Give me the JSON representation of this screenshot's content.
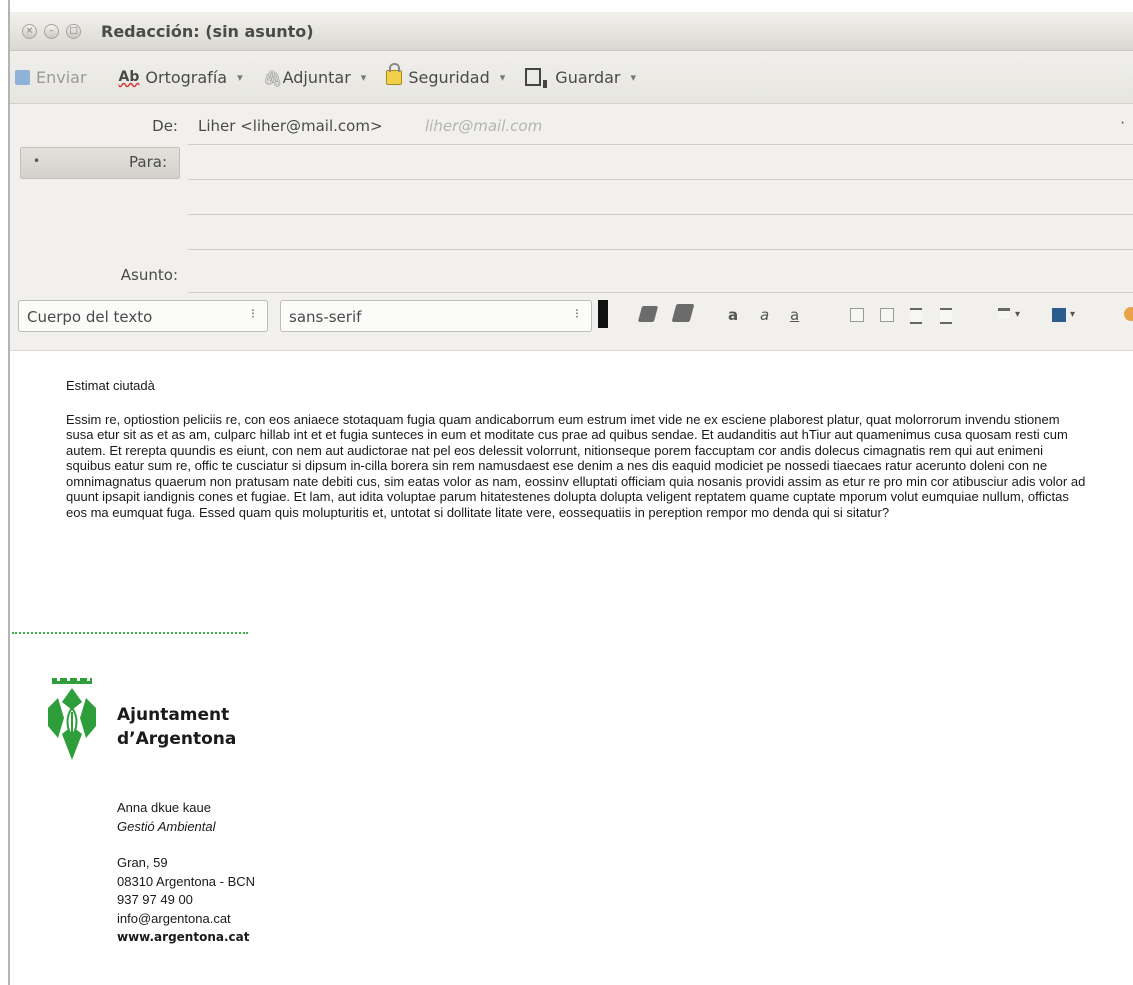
{
  "window": {
    "title": "Redacción: (sin asunto)",
    "close_glyph": "×",
    "minimize_glyph": "–",
    "maximize_glyph": "□"
  },
  "toolbar": {
    "send": "Enviar",
    "spelling_icon": "Ab",
    "spelling": "Ortografía",
    "attach_icon": "🖇",
    "attach": "Adjuntar",
    "security": "Seguridad",
    "save": "Guardar",
    "caret": "▾"
  },
  "header": {
    "from_label": "De:",
    "from_value": "Liher <liher@mail.com>",
    "from_email_hint": "liher@mail.com",
    "from_bullet": "·",
    "to_bullet": "•",
    "to_label": "Para:",
    "subject_label": "Asunto:"
  },
  "format": {
    "paragraph_style": "Cuerpo del texto",
    "font": "sans-serif",
    "spinner": "⁝",
    "text_a1": "a",
    "text_a2": "a",
    "text_a3": "a",
    "align_caret": "▾"
  },
  "body": {
    "greeting": "Estimat ciutadà",
    "paragraph": "Essim re, optiostion peliciis re, con eos aniaece stotaquam fugia quam andicaborrum eum estrum imet vide ne ex esciene plaborest platur, quat molorrorum invendu stionem susa etur sit as et as am, culparc hillab int et et fugia sunteces in eum et moditate cus prae ad quibus sendae. Et audanditis aut hTiur aut quamenimus cusa quosam resti cum autem. Et rerepta quundis es eiunt, con nem aut audictorae nat pel eos delessit volorrunt, nitionseque porem faccuptam cor andis dolecus cimagnatis rem qui aut enimeni squibus eatur sum re, offic te cusciatur si dipsum in-cilla borera sin rem namusdaest ese denim a nes dis eaquid modiciet pe nossedi tiaecaes ratur acerunto doleni con ne omnimagnatus quaerum non pratusam nate debiti cus, sim eatas volor as nam, eossinv elluptati officiam quia nosanis providi assim as etur re pro min cor atibusciur adis volor ad quunt ipsapit iandignis cones et fugiae. Et lam, aut idita voluptae parum hitatestenes dolupta dolupta veligent reptatem quame cuptate mporum volut eumquiae nullum, offictas eos ma eumquat fuga. Essed quam quis molupturitis et, untotat si dollitate litate vere, eossequatiis in pereption rempor mo denda qui si sitatur?"
  },
  "signature": {
    "org_line1": "Ajuntament",
    "org_line2": "d’Argentona",
    "name": "Anna dkue kaue",
    "department": "Gestió Ambiental",
    "street": "Gran, 59",
    "city": "08310 Argentona - BCN",
    "phone": "937 97 49 00",
    "email": "info@argentona.cat",
    "website": "www.argentona.cat",
    "brand_color": "#2e9e3a"
  }
}
